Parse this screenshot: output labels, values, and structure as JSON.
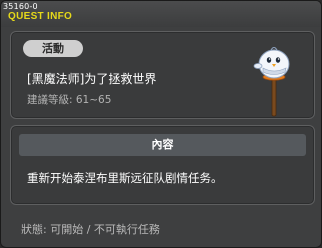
{
  "window": {
    "quest_id": "35160-0",
    "title": "QUEST INFO"
  },
  "quest": {
    "category_badge": "活動",
    "name": "[黑魔法师]为了拯救世界",
    "level": "建議等級: 61~65",
    "npc_icon": "snowman-npc-icon"
  },
  "content": {
    "header": "內容",
    "description": "重新开始泰涅布里斯远征队剧情任务。"
  },
  "status": {
    "text": "狀態: 可開始 / 不可執行任務"
  },
  "colors": {
    "title": "#e6d91a",
    "background": "#3e3f40",
    "badge": "#cfcfcf"
  }
}
